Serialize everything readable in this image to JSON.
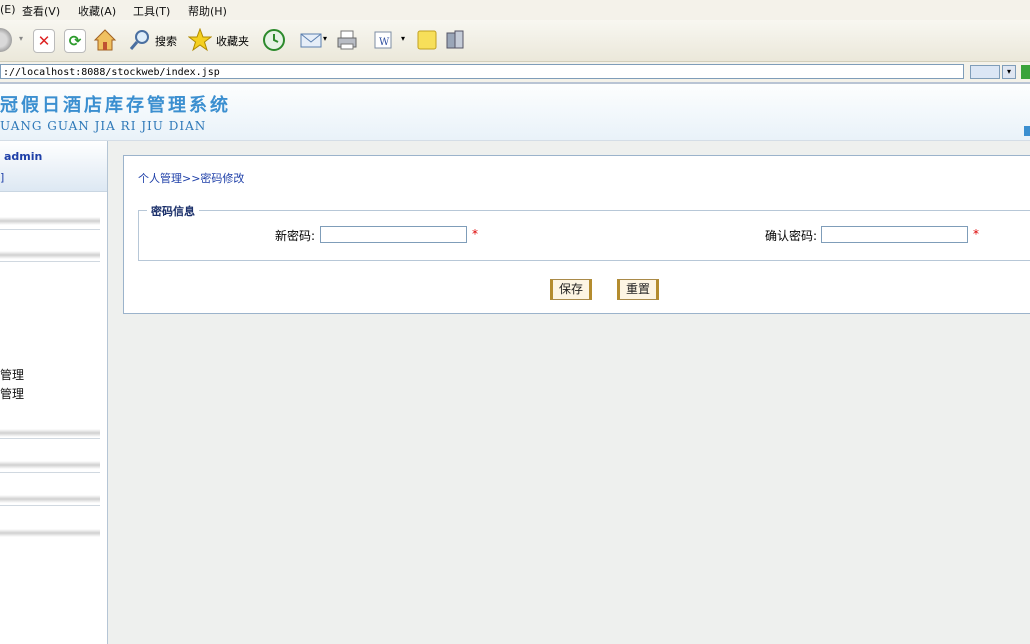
{
  "menu": [
    "(E)",
    "查看(V)",
    "收藏(A)",
    "工具(T)",
    "帮助(H)"
  ],
  "toolbar": {
    "search_label": "搜索",
    "favorites_label": "收藏夹"
  },
  "address": {
    "url": "://localhost:8088/stockweb/index.jsp"
  },
  "header": {
    "title": "冠假日酒店库存管理系统",
    "subtitle": "UANG GUAN JIA RI JIU DIAN"
  },
  "sidebar": {
    "user": "admin",
    "user_sub": "]",
    "items": [
      "管理",
      "管理"
    ]
  },
  "main": {
    "breadcrumb": "个人管理>>密码修改",
    "legend": "密码信息",
    "new_password_label": "新密码:",
    "confirm_password_label": "确认密码:",
    "required_mark": "*",
    "save_label": "保存",
    "reset_label": "重置"
  },
  "colors": {
    "title": "#3b8fd0",
    "panel_border": "#9bb3cb",
    "breadcrumb": "#1e3fa8",
    "required": "#dd0000"
  }
}
